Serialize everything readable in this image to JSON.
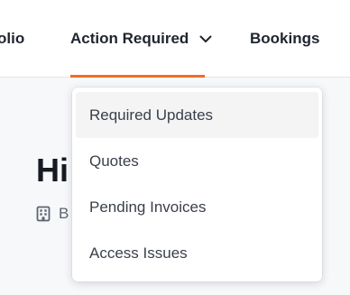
{
  "nav": {
    "items": [
      {
        "label": "olio"
      },
      {
        "label": "Action Required"
      },
      {
        "label": "Bookings"
      }
    ],
    "accent_color": "#f26b21"
  },
  "page": {
    "heading": "Hi",
    "subtitle": "B"
  },
  "dropdown": {
    "items": [
      {
        "label": "Required Updates"
      },
      {
        "label": "Quotes"
      },
      {
        "label": "Pending Invoices"
      },
      {
        "label": "Access Issues"
      }
    ]
  },
  "icons": {
    "nav_chevron": "chevron-down-icon",
    "subtitle_icon": "building-icon"
  }
}
